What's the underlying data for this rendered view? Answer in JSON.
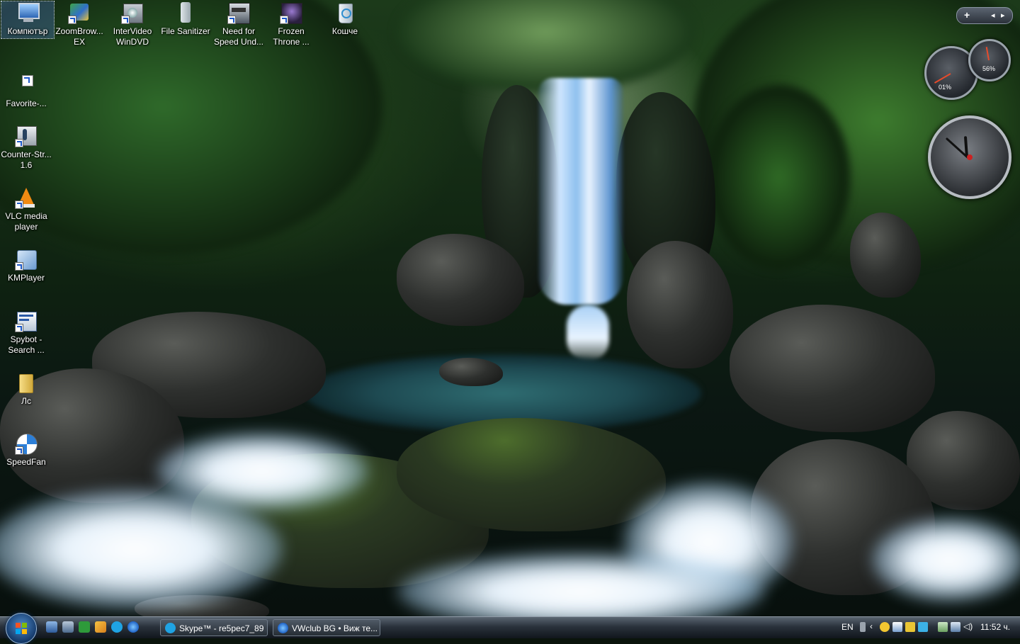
{
  "desktop": {
    "icons": [
      {
        "name": "computer",
        "label": "Компютър"
      },
      {
        "name": "zoombrowser",
        "label": "ZoomBrow... EX"
      },
      {
        "name": "intervideo-windvd",
        "label": "InterVideo WinDVD"
      },
      {
        "name": "file-sanitizer",
        "label": "File Sanitizer"
      },
      {
        "name": "need-for-speed",
        "label": "Need for Speed Und..."
      },
      {
        "name": "frozen-throne",
        "label": "Frozen Throne ..."
      },
      {
        "name": "recycle-bin",
        "label": "Кошче"
      },
      {
        "name": "favorites",
        "label": "Favorite-..."
      },
      {
        "name": "counter-strike",
        "label": "Counter-Str... 1.6"
      },
      {
        "name": "vlc",
        "label": "VLC media player"
      },
      {
        "name": "kmplayer",
        "label": "KMPlayer"
      },
      {
        "name": "spybot",
        "label": "Spybot - Search ..."
      },
      {
        "name": "folder-lic",
        "label": "Лс"
      },
      {
        "name": "speedfan",
        "label": "SpeedFan"
      }
    ]
  },
  "gadgets": {
    "sidebar_add": "+",
    "sidebar_prev": "◂",
    "sidebar_next": "▸",
    "cpu_meter": {
      "cpu_label": "01%",
      "ram_label": "56%"
    },
    "clock": {
      "hour": 11,
      "minute": 52
    }
  },
  "taskbar": {
    "quick_launch": [
      "show-desktop",
      "switch-windows",
      "utorrent",
      "winamp",
      "skype",
      "internet-explorer"
    ],
    "buttons": [
      {
        "name": "skype",
        "label": "Skype™ - re5pec7_89"
      },
      {
        "name": "vwclub",
        "label": "VWclub BG • Виж те..."
      }
    ],
    "tray": {
      "language": "EN",
      "time": "11:52 ч."
    }
  },
  "colors": {
    "taskbar_top": "#5a6571",
    "taskbar_bottom": "#11161c",
    "accent": "#4e89c9"
  }
}
